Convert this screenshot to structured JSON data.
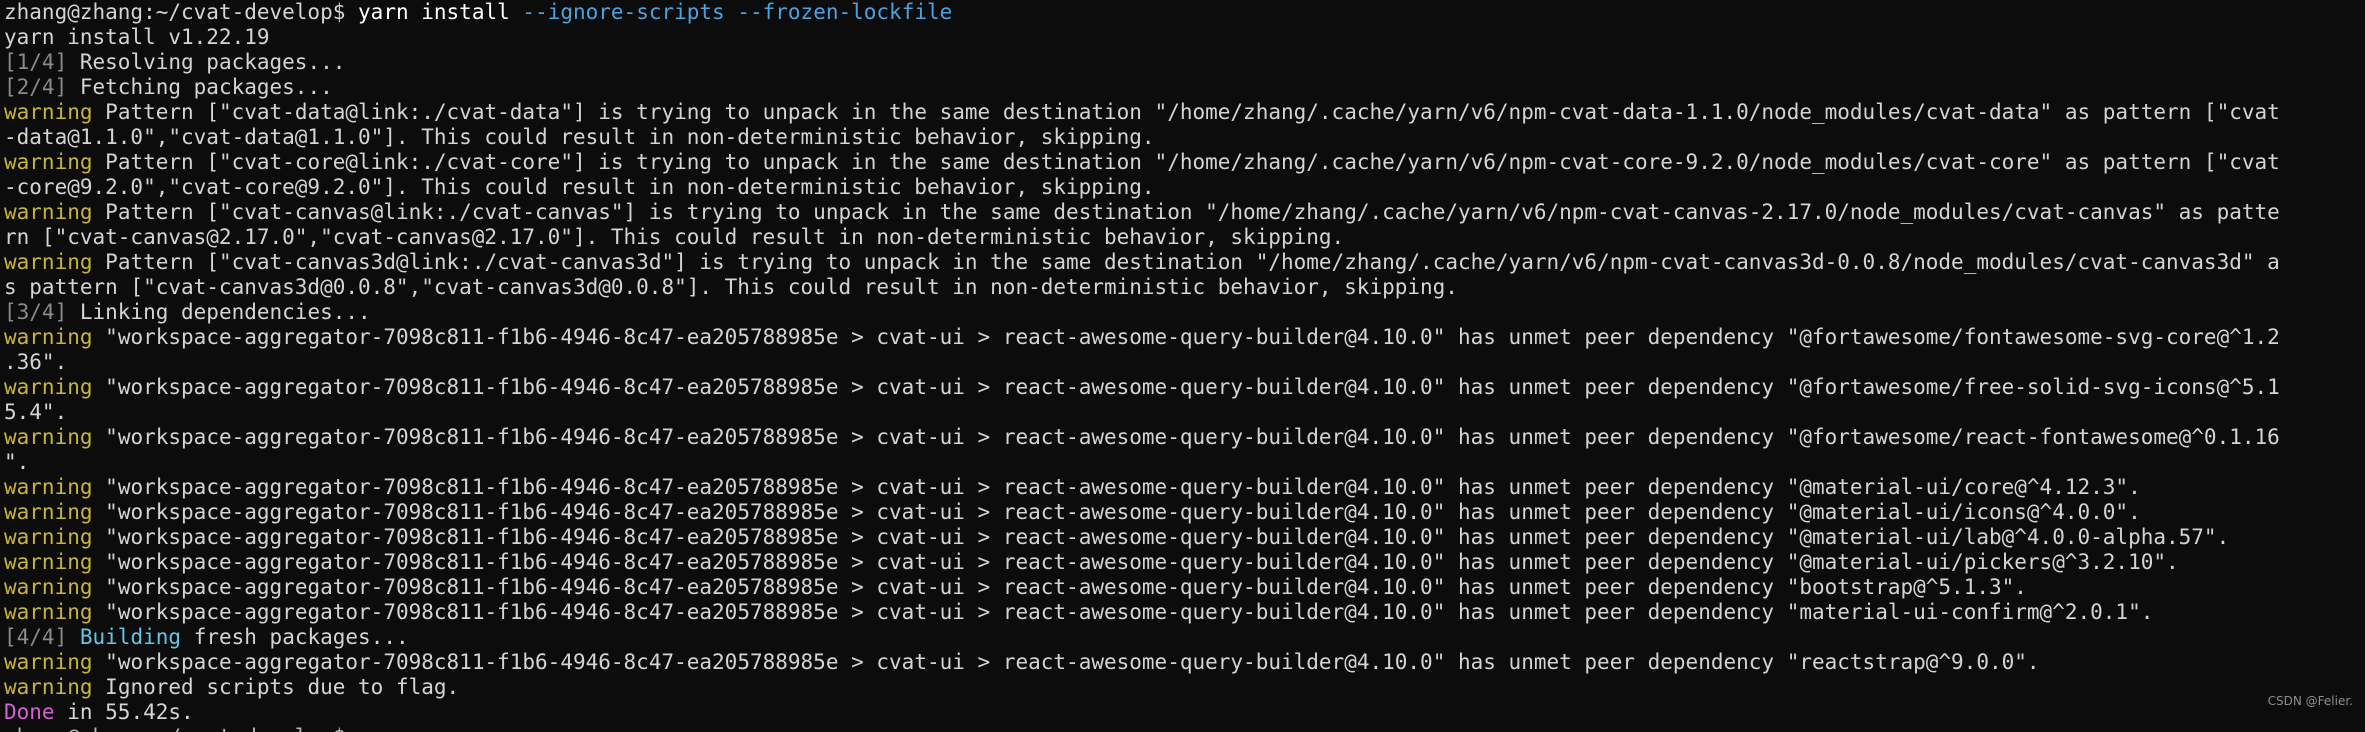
{
  "terminal": {
    "prompt": "zhang@zhang:~/cvat-develop$",
    "command": "yarn install",
    "flags": "--ignore-scripts --frozen-lockfile",
    "version_line": "yarn install v1.22.19",
    "steps": {
      "resolving": {
        "tag": "[1/4]",
        "text": "Resolving packages..."
      },
      "fetching": {
        "tag": "[2/4]",
        "text": "Fetching packages..."
      },
      "linking": {
        "tag": "[3/4]",
        "text": "Linking dependencies..."
      },
      "building": {
        "tag": "[4/4]",
        "word": "Building",
        "text": "fresh packages..."
      }
    },
    "warning_label": "warning",
    "pattern_warnings": [
      {
        "line1": "Pattern [\"cvat-data@link:./cvat-data\"] is trying to unpack in the same destination \"/home/zhang/.cache/yarn/v6/npm-cvat-data-1.1.0/node_modules/cvat-data\" as pattern [\"cvat",
        "line2": "-data@1.1.0\",\"cvat-data@1.1.0\"]. This could result in non-deterministic behavior, skipping."
      },
      {
        "line1": "Pattern [\"cvat-core@link:./cvat-core\"] is trying to unpack in the same destination \"/home/zhang/.cache/yarn/v6/npm-cvat-core-9.2.0/node_modules/cvat-core\" as pattern [\"cvat",
        "line2": "-core@9.2.0\",\"cvat-core@9.2.0\"]. This could result in non-deterministic behavior, skipping."
      },
      {
        "line1": "Pattern [\"cvat-canvas@link:./cvat-canvas\"] is trying to unpack in the same destination \"/home/zhang/.cache/yarn/v6/npm-cvat-canvas-2.17.0/node_modules/cvat-canvas\" as patte",
        "line2": "rn [\"cvat-canvas@2.17.0\",\"cvat-canvas@2.17.0\"]. This could result in non-deterministic behavior, skipping."
      },
      {
        "line1": "Pattern [\"cvat-canvas3d@link:./cvat-canvas3d\"] is trying to unpack in the same destination \"/home/zhang/.cache/yarn/v6/npm-cvat-canvas3d-0.0.8/node_modules/cvat-canvas3d\" a",
        "line2": "s pattern [\"cvat-canvas3d@0.0.8\",\"cvat-canvas3d@0.0.8\"]. This could result in non-deterministic behavior, skipping."
      }
    ],
    "peer_warnings_wrapped": [
      {
        "line1": "\"workspace-aggregator-7098c811-f1b6-4946-8c47-ea205788985e > cvat-ui > react-awesome-query-builder@4.10.0\" has unmet peer dependency \"@fortawesome/fontawesome-svg-core@^1.2",
        "line2": ".36\"."
      },
      {
        "line1": "\"workspace-aggregator-7098c811-f1b6-4946-8c47-ea205788985e > cvat-ui > react-awesome-query-builder@4.10.0\" has unmet peer dependency \"@fortawesome/free-solid-svg-icons@^5.1",
        "line2": "5.4\"."
      },
      {
        "line1": "\"workspace-aggregator-7098c811-f1b6-4946-8c47-ea205788985e > cvat-ui > react-awesome-query-builder@4.10.0\" has unmet peer dependency \"@fortawesome/react-fontawesome@^0.1.16",
        "line2": "\"."
      }
    ],
    "peer_warnings": [
      "\"workspace-aggregator-7098c811-f1b6-4946-8c47-ea205788985e > cvat-ui > react-awesome-query-builder@4.10.0\" has unmet peer dependency \"@material-ui/core@^4.12.3\".",
      "\"workspace-aggregator-7098c811-f1b6-4946-8c47-ea205788985e > cvat-ui > react-awesome-query-builder@4.10.0\" has unmet peer dependency \"@material-ui/icons@^4.0.0\".",
      "\"workspace-aggregator-7098c811-f1b6-4946-8c47-ea205788985e > cvat-ui > react-awesome-query-builder@4.10.0\" has unmet peer dependency \"@material-ui/lab@^4.0.0-alpha.57\".",
      "\"workspace-aggregator-7098c811-f1b6-4946-8c47-ea205788985e > cvat-ui > react-awesome-query-builder@4.10.0\" has unmet peer dependency \"@material-ui/pickers@^3.2.10\".",
      "\"workspace-aggregator-7098c811-f1b6-4946-8c47-ea205788985e > cvat-ui > react-awesome-query-builder@4.10.0\" has unmet peer dependency \"bootstrap@^5.1.3\".",
      "\"workspace-aggregator-7098c811-f1b6-4946-8c47-ea205788985e > cvat-ui > react-awesome-query-builder@4.10.0\" has unmet peer dependency \"material-ui-confirm@^2.0.1\".",
      "\"workspace-aggregator-7098c811-f1b6-4946-8c47-ea205788985e > cvat-ui > react-awesome-query-builder@4.10.0\" has unmet peer dependency \"reactstrap@^9.0.0\"."
    ],
    "last_peer_warning": "\"workspace-aggregator-7098c811-f1b6-4946-8c47-ea205788985e > cvat-ui > react-awesome-query-builder@4.10.0\" has unmet peer dependency \"reactstrap@^9.0.0\".",
    "ignored_scripts": "Ignored scripts due to flag.",
    "done_word": "Done",
    "done_text": "in 55.42s.",
    "watermark": "CSDN @Felier.",
    "colors": {
      "background": "#0c0c0c",
      "text": "#d4d4d4",
      "warning": "#c8b63a",
      "step": "#8a8a8a",
      "flag": "#4aa3df",
      "done": "#d75fd7",
      "info": "#61c7e6"
    }
  }
}
